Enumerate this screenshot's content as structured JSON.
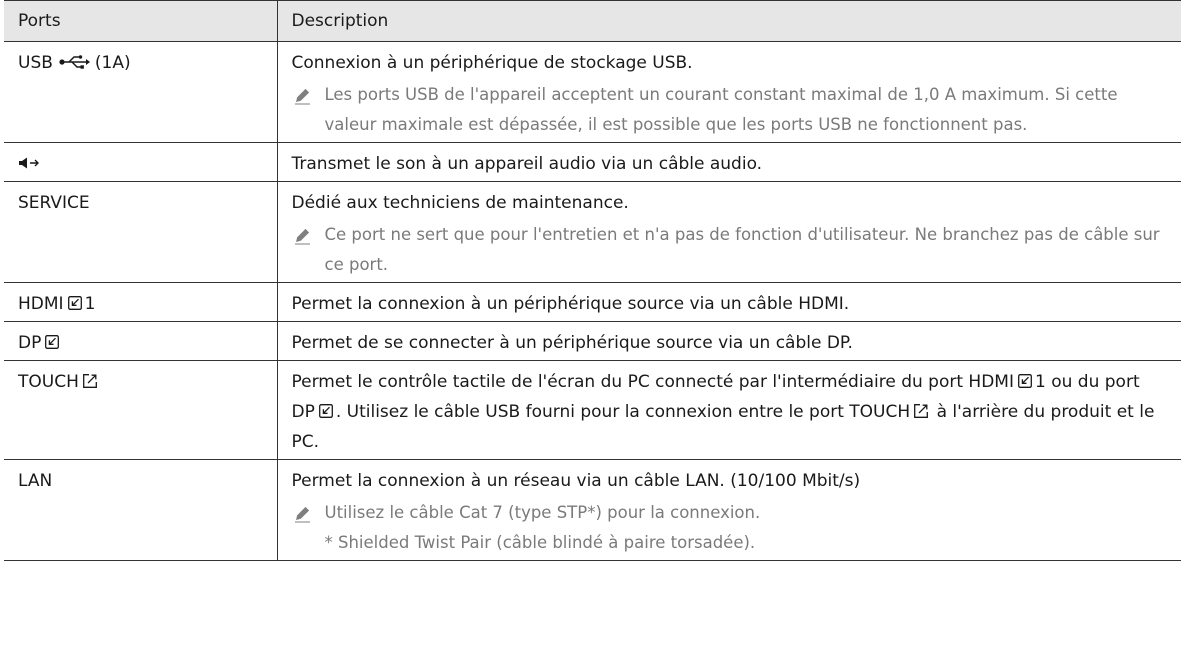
{
  "header": {
    "col_ports": "Ports",
    "col_description": "Description"
  },
  "rows": [
    {
      "port": "USB",
      "port_suffix": "(1A)",
      "port_icon": "usb-icon",
      "description": "Connexion à un périphérique de stockage USB.",
      "note": "Les ports USB de l'appareil acceptent un courant constant maximal de 1,0 A maximum. Si cette valeur maximale est dépassée, il est possible que les ports USB ne fonctionnent pas."
    },
    {
      "port_icon": "audio-out-icon",
      "description": "Transmet le son à un appareil audio via un câble audio."
    },
    {
      "port": "SERVICE",
      "description": "Dédié aux techniciens de maintenance.",
      "note": "Ce port ne sert que pour l'entretien et n'a pas de fonction d'utilisateur. Ne branchez pas de câble sur ce port."
    },
    {
      "port": "HDMI",
      "port_suffix": "1",
      "port_icon": "input-icon",
      "description": "Permet la connexion à un périphérique source via un câble HDMI."
    },
    {
      "port": "DP",
      "port_icon": "input-icon",
      "description": "Permet de se connecter à un périphérique source via un câble DP."
    },
    {
      "port": "TOUCH",
      "port_icon": "output-icon",
      "description_parts": {
        "p1": "Permet le contrôle tactile de l'écran du PC connecté par l'intermédiaire du port",
        "hdmi": "HDMI",
        "hdmi_num": "1",
        "p2": "ou du port",
        "dp": "DP",
        "p3": ". Utilisez le câble USB fourni pour la connexion entre le port",
        "touch": "TOUCH",
        "p4": "à l'arrière du produit et le PC."
      }
    },
    {
      "port": "LAN",
      "description": "Permet la connexion à un réseau via un câble LAN. (10/100 Mbit/s)",
      "note": "Utilisez le câble Cat 7 (type STP*) pour la connexion.",
      "note_sub": "* Shielded Twist Pair (câble blindé à paire torsadée)."
    }
  ]
}
